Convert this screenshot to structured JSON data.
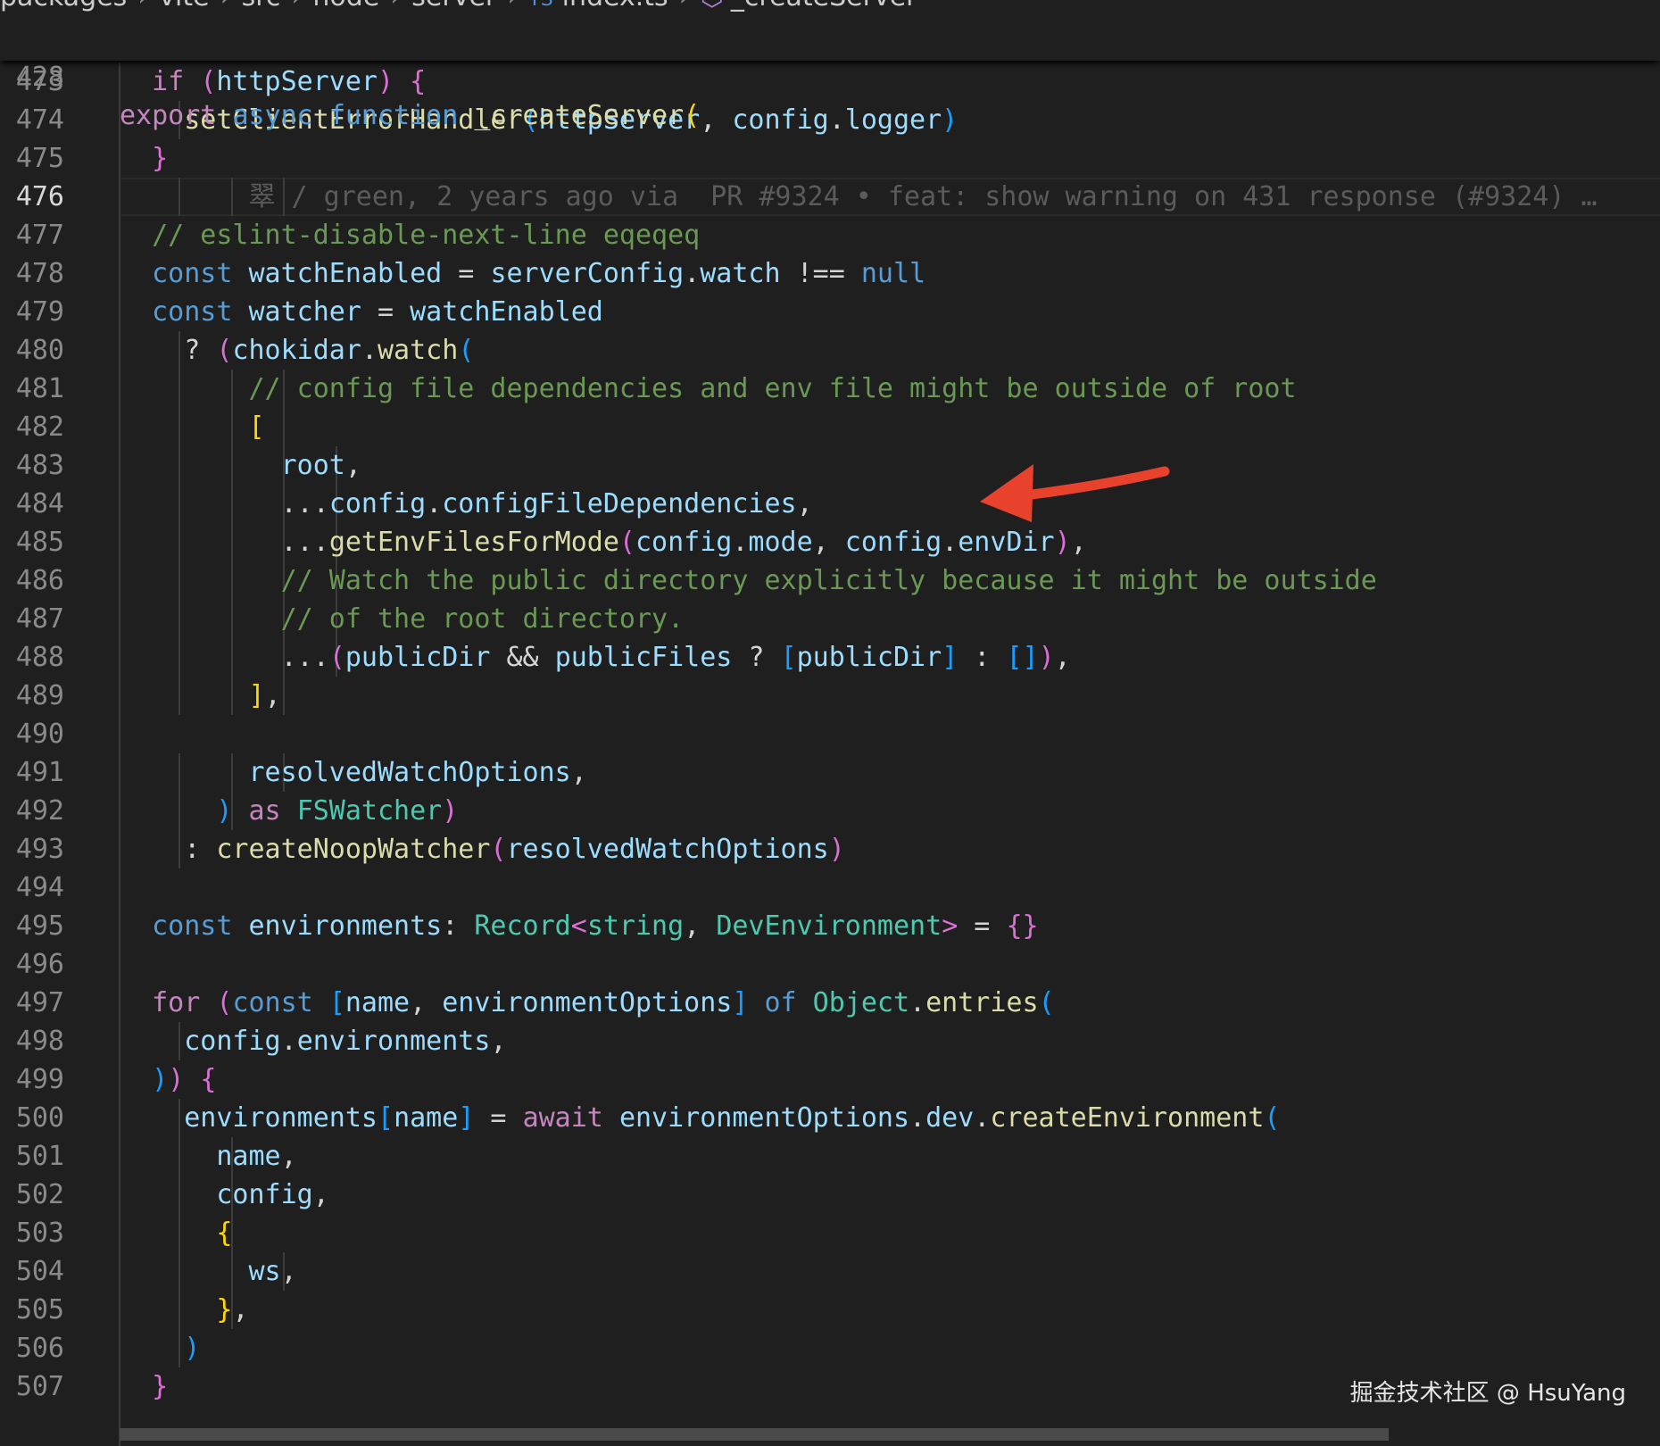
{
  "breadcrumb": {
    "parts": [
      "packages",
      "vite",
      "src",
      "node",
      "server"
    ],
    "ts_badge": "TS",
    "file": "index.ts",
    "symbol": "_createServer"
  },
  "sticky": {
    "line_number": "428",
    "tokens": [
      [
        "export ",
        "k"
      ],
      [
        "async ",
        "s"
      ],
      [
        "function ",
        "s"
      ],
      [
        "_createServer",
        "f"
      ],
      [
        "(",
        "b1"
      ]
    ]
  },
  "lines": [
    {
      "n": "473",
      "tokens": [
        [
          "  "
        ],
        [
          "if ",
          "k"
        ],
        [
          "(",
          "b2"
        ],
        [
          "httpServer",
          "v"
        ],
        [
          ")",
          "b2"
        ],
        [
          " "
        ],
        [
          "{",
          "b2"
        ]
      ]
    },
    {
      "n": "474",
      "tokens": [
        [
          "    "
        ],
        [
          "setClientErrorHandler",
          "f"
        ],
        [
          "(",
          "b3"
        ],
        [
          "httpServer",
          "v"
        ],
        [
          ", "
        ],
        [
          "config",
          "v"
        ],
        [
          "."
        ],
        [
          "logger",
          "v"
        ],
        [
          ")",
          "b3"
        ]
      ]
    },
    {
      "n": "475",
      "tokens": [
        [
          "  "
        ],
        [
          "}",
          "b2"
        ]
      ]
    },
    {
      "n": "476",
      "active": true,
      "tokens": [
        [
          "        "
        ],
        [
          "翠 / green, 2 years ago via  PR #9324 • feat: show warning on 431 response (#9324) …",
          "blame"
        ]
      ]
    },
    {
      "n": "477",
      "tokens": [
        [
          "  "
        ],
        [
          "// eslint-disable-next-line eqeqeq",
          "c"
        ]
      ]
    },
    {
      "n": "478",
      "tokens": [
        [
          "  "
        ],
        [
          "const ",
          "s"
        ],
        [
          "watchEnabled",
          "v"
        ],
        [
          " = "
        ],
        [
          "serverConfig",
          "v"
        ],
        [
          "."
        ],
        [
          "watch",
          "v"
        ],
        [
          " !== "
        ],
        [
          "null",
          "s"
        ]
      ]
    },
    {
      "n": "479",
      "tokens": [
        [
          "  "
        ],
        [
          "const ",
          "s"
        ],
        [
          "watcher",
          "v"
        ],
        [
          " = "
        ],
        [
          "watchEnabled",
          "v"
        ]
      ]
    },
    {
      "n": "480",
      "tokens": [
        [
          "    ? "
        ],
        [
          "(",
          "b2"
        ],
        [
          "chokidar",
          "v"
        ],
        [
          "."
        ],
        [
          "watch",
          "f"
        ],
        [
          "(",
          "b3"
        ]
      ]
    },
    {
      "n": "481",
      "tokens": [
        [
          "        "
        ],
        [
          "// config file dependencies and env file might be outside of root",
          "c"
        ]
      ]
    },
    {
      "n": "482",
      "tokens": [
        [
          "        "
        ],
        [
          "[",
          "b1"
        ]
      ]
    },
    {
      "n": "483",
      "tokens": [
        [
          "          "
        ],
        [
          "root",
          "v"
        ],
        [
          ","
        ]
      ]
    },
    {
      "n": "484",
      "tokens": [
        [
          "          ..."
        ],
        [
          "config",
          "v"
        ],
        [
          "."
        ],
        [
          "configFileDependencies",
          "v"
        ],
        [
          ","
        ]
      ]
    },
    {
      "n": "485",
      "tokens": [
        [
          "          ..."
        ],
        [
          "getEnvFilesForMode",
          "f"
        ],
        [
          "(",
          "b2"
        ],
        [
          "config",
          "v"
        ],
        [
          "."
        ],
        [
          "mode",
          "v"
        ],
        [
          ", "
        ],
        [
          "config",
          "v"
        ],
        [
          "."
        ],
        [
          "envDir",
          "v"
        ],
        [
          ")",
          "b2"
        ],
        [
          ","
        ]
      ]
    },
    {
      "n": "486",
      "tokens": [
        [
          "          "
        ],
        [
          "// Watch the public directory explicitly because it might be outside",
          "c"
        ]
      ]
    },
    {
      "n": "487",
      "tokens": [
        [
          "          "
        ],
        [
          "// of the root directory.",
          "c"
        ]
      ]
    },
    {
      "n": "488",
      "tokens": [
        [
          "          ..."
        ],
        [
          "(",
          "b2"
        ],
        [
          "publicDir",
          "v"
        ],
        [
          " && "
        ],
        [
          "publicFiles",
          "v"
        ],
        [
          " ? "
        ],
        [
          "[",
          "b3"
        ],
        [
          "publicDir",
          "v"
        ],
        [
          "]",
          "b3"
        ],
        [
          " : "
        ],
        [
          "[]",
          "b3"
        ],
        [
          ")",
          "b2"
        ],
        [
          ","
        ]
      ]
    },
    {
      "n": "489",
      "tokens": [
        [
          "        "
        ],
        [
          "]",
          "b1"
        ],
        [
          ","
        ]
      ]
    },
    {
      "n": "490",
      "tokens": [
        [
          ""
        ]
      ]
    },
    {
      "n": "491",
      "tokens": [
        [
          "        "
        ],
        [
          "resolvedWatchOptions",
          "v"
        ],
        [
          ","
        ]
      ]
    },
    {
      "n": "492",
      "tokens": [
        [
          "      "
        ],
        [
          ")",
          "b3"
        ],
        [
          " "
        ],
        [
          "as ",
          "k"
        ],
        [
          "FSWatcher",
          "t"
        ],
        [
          ")",
          "b2"
        ]
      ]
    },
    {
      "n": "493",
      "tokens": [
        [
          "    : "
        ],
        [
          "createNoopWatcher",
          "f"
        ],
        [
          "(",
          "b2"
        ],
        [
          "resolvedWatchOptions",
          "v"
        ],
        [
          ")",
          "b2"
        ]
      ]
    },
    {
      "n": "494",
      "tokens": [
        [
          ""
        ]
      ]
    },
    {
      "n": "495",
      "tokens": [
        [
          "  "
        ],
        [
          "const ",
          "s"
        ],
        [
          "environments",
          "v"
        ],
        [
          ": "
        ],
        [
          "Record",
          "t"
        ],
        [
          "<",
          "b2"
        ],
        [
          "string",
          "t"
        ],
        [
          ", "
        ],
        [
          "DevEnvironment",
          "t"
        ],
        [
          ">",
          "b2"
        ],
        [
          " = "
        ],
        [
          "{}",
          "b2"
        ]
      ]
    },
    {
      "n": "496",
      "tokens": [
        [
          ""
        ]
      ]
    },
    {
      "n": "497",
      "tokens": [
        [
          "  "
        ],
        [
          "for ",
          "k"
        ],
        [
          "(",
          "b2"
        ],
        [
          "const ",
          "s"
        ],
        [
          "[",
          "b3"
        ],
        [
          "name",
          "v"
        ],
        [
          ", "
        ],
        [
          "environmentOptions",
          "v"
        ],
        [
          "]",
          "b3"
        ],
        [
          " "
        ],
        [
          "of ",
          "s"
        ],
        [
          "Object",
          "t"
        ],
        [
          "."
        ],
        [
          "entries",
          "f"
        ],
        [
          "(",
          "b3"
        ]
      ]
    },
    {
      "n": "498",
      "tokens": [
        [
          "    "
        ],
        [
          "config",
          "v"
        ],
        [
          "."
        ],
        [
          "environments",
          "v"
        ],
        [
          ","
        ]
      ]
    },
    {
      "n": "499",
      "tokens": [
        [
          "  "
        ],
        [
          ")",
          "b3"
        ],
        [
          ")",
          "b2"
        ],
        [
          " "
        ],
        [
          "{",
          "b2"
        ]
      ]
    },
    {
      "n": "500",
      "tokens": [
        [
          "    "
        ],
        [
          "environments",
          "v"
        ],
        [
          "[",
          "b3"
        ],
        [
          "name",
          "v"
        ],
        [
          "]",
          "b3"
        ],
        [
          " = "
        ],
        [
          "await ",
          "k"
        ],
        [
          "environmentOptions",
          "v"
        ],
        [
          "."
        ],
        [
          "dev",
          "v"
        ],
        [
          "."
        ],
        [
          "createEnvironment",
          "f"
        ],
        [
          "(",
          "b3"
        ]
      ]
    },
    {
      "n": "501",
      "tokens": [
        [
          "      "
        ],
        [
          "name",
          "v"
        ],
        [
          ","
        ]
      ]
    },
    {
      "n": "502",
      "tokens": [
        [
          "      "
        ],
        [
          "config",
          "v"
        ],
        [
          ","
        ]
      ]
    },
    {
      "n": "503",
      "tokens": [
        [
          "      "
        ],
        [
          "{",
          "b1"
        ]
      ]
    },
    {
      "n": "504",
      "tokens": [
        [
          "        "
        ],
        [
          "ws",
          "v"
        ],
        [
          ","
        ]
      ]
    },
    {
      "n": "505",
      "tokens": [
        [
          "      "
        ],
        [
          "}",
          "b1"
        ],
        [
          ","
        ]
      ]
    },
    {
      "n": "506",
      "tokens": [
        [
          "    "
        ],
        [
          ")",
          "b3"
        ]
      ]
    },
    {
      "n": "507",
      "tokens": [
        [
          "  "
        ],
        [
          "}",
          "b2"
        ]
      ]
    }
  ],
  "annotation": {
    "color": "#e8412c"
  },
  "watermark": "掘金技术社区 @ HsuYang"
}
